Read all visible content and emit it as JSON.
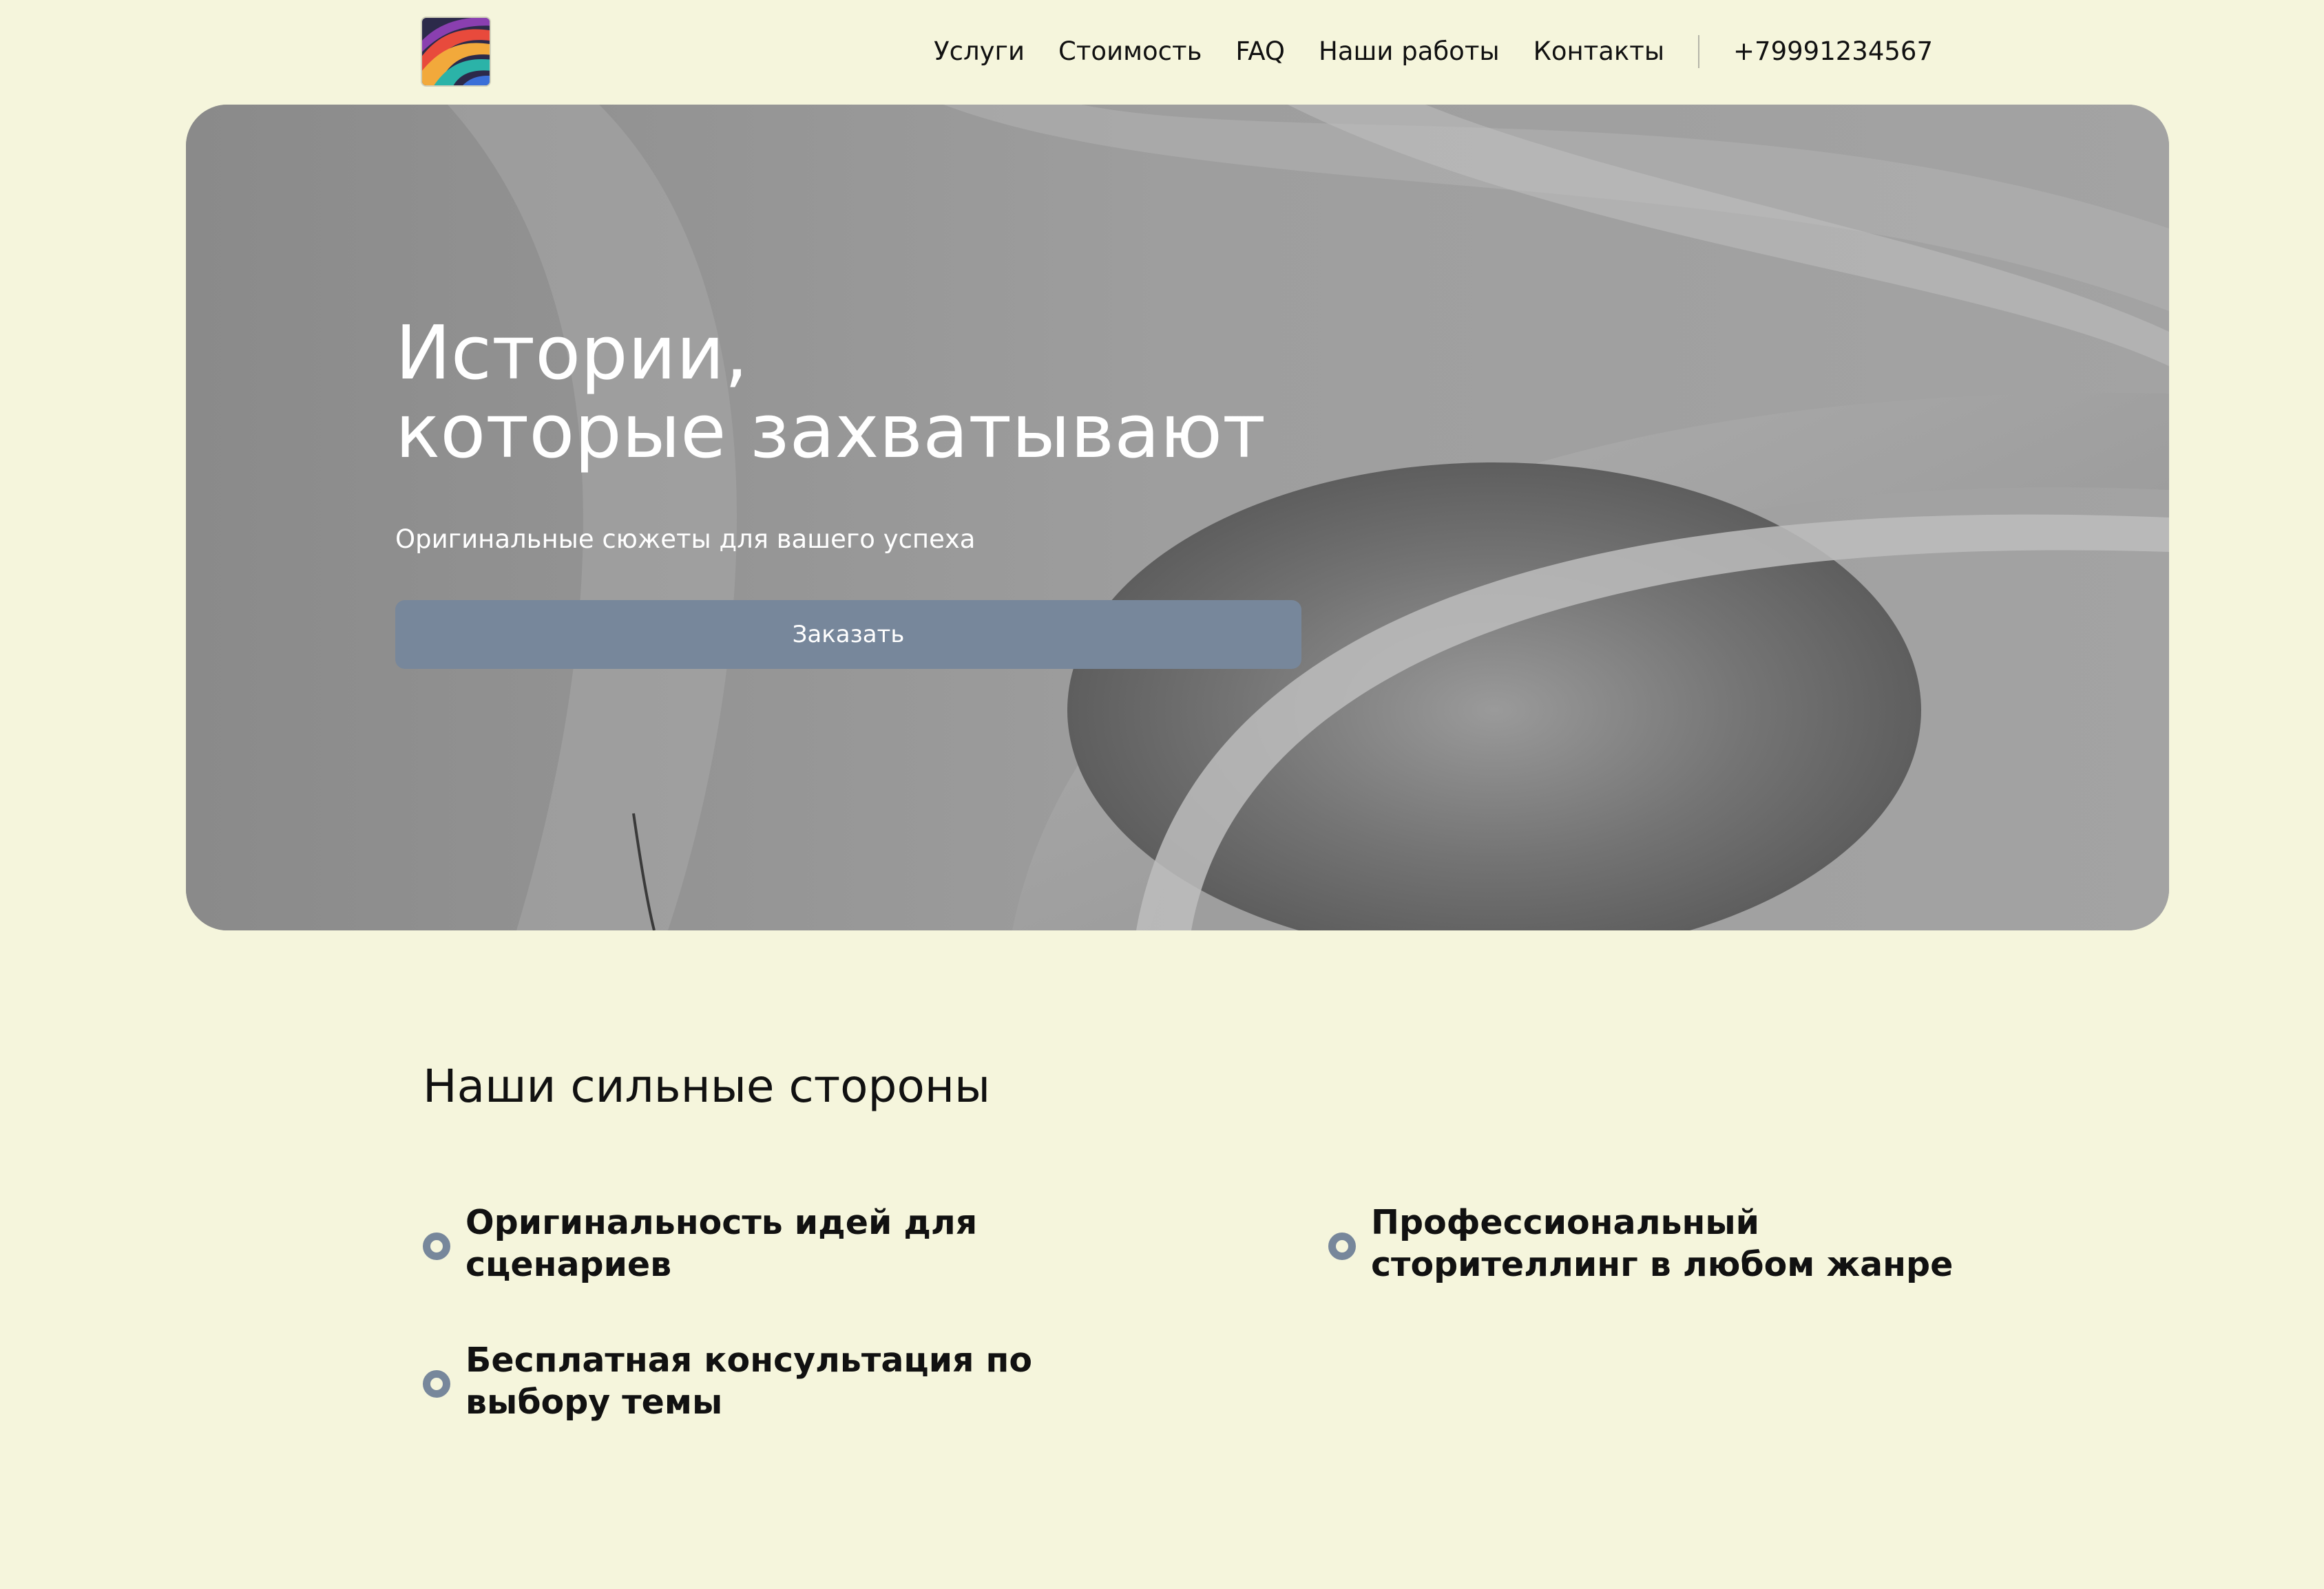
{
  "nav": {
    "items": [
      "Услуги",
      "Стоимость",
      "FAQ",
      "Наши работы",
      "Контакты"
    ],
    "phone": "+79991234567"
  },
  "hero": {
    "title_lines": [
      "Истории,",
      "которые захватывают"
    ],
    "subtitle": "Оригинальные сюжеты для вашего успеха",
    "button": "Заказать"
  },
  "strengths": {
    "title": "Наши сильные стороны",
    "items": [
      {
        "lines": [
          "Оригинальность идей для",
          "сценариев"
        ]
      },
      {
        "lines": [
          "Профессиональный",
          "сторителлинг в любом жанре"
        ]
      },
      {
        "lines": [
          "Бесплатная консультация по",
          "выбору темы"
        ]
      }
    ]
  },
  "colors": {
    "background": "#f5f5dc",
    "accent": "#77879b",
    "hero_text": "#ffffff"
  },
  "icons": {
    "logo": "colorful-swirl-logo-icon",
    "bullet": "ring-bullet-icon"
  }
}
